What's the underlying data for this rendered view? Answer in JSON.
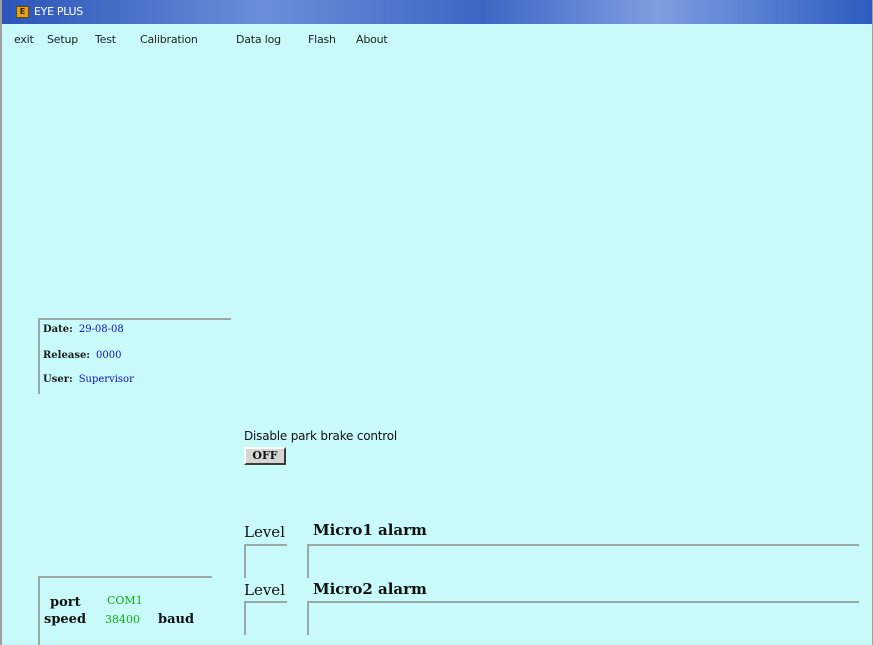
{
  "window": {
    "title": "EYE PLUS",
    "icon": "app-icon"
  },
  "menu": {
    "items": [
      "exit",
      "Setup",
      "Test",
      "Calibration",
      "Data log",
      "Flash",
      "About"
    ]
  },
  "info": {
    "date_label": "Date:",
    "date_value": "29-08-08",
    "release_label": "Release:",
    "release_value": "0000",
    "user_label": "User:",
    "user_value": "Supervisor"
  },
  "brake": {
    "label": "Disable park brake control",
    "button_label": "OFF"
  },
  "alarms": {
    "level1_label": "Level",
    "alarm1_label": "Micro1 alarm",
    "level2_label": "Level",
    "alarm2_label": "Micro2 alarm"
  },
  "comm": {
    "port_label": "port",
    "port_value": "COM1",
    "speed_label": "speed",
    "speed_value": "38400",
    "speed_unit": "baud"
  },
  "colors": {
    "background": "#c8fafa",
    "value_blue": "#1010c0",
    "value_green": "#10b010"
  }
}
